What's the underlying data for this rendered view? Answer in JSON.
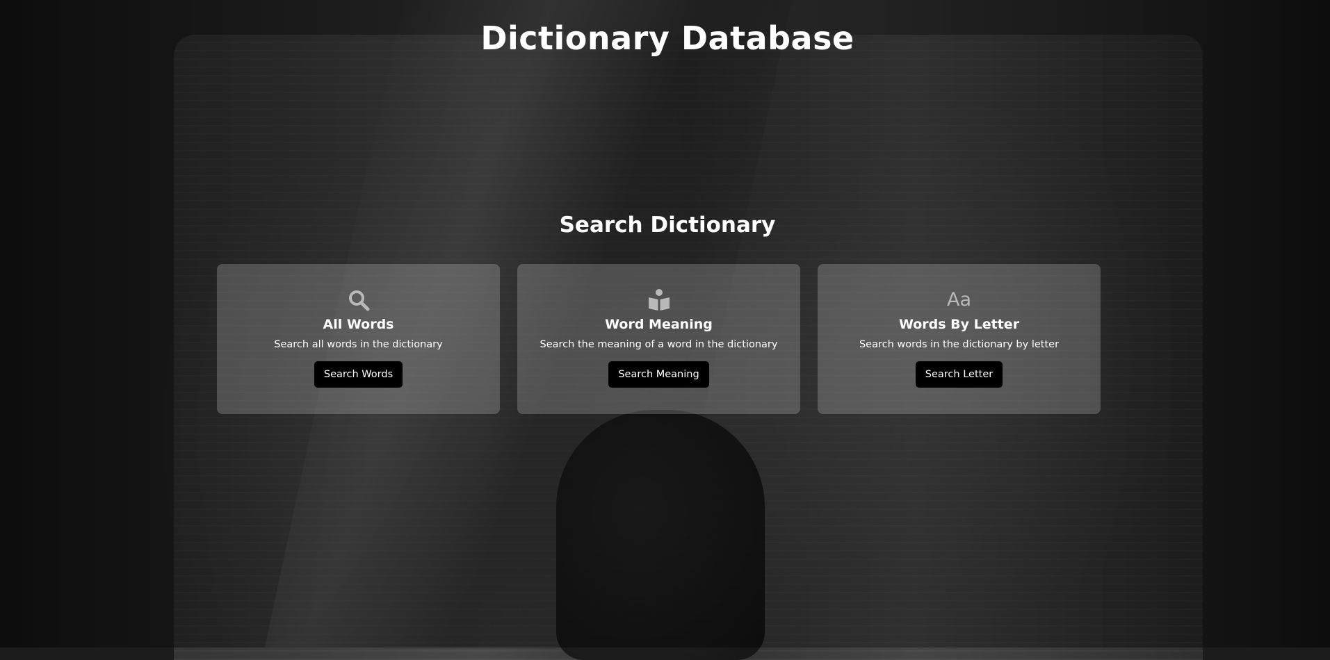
{
  "header": {
    "title": "Dictionary Database"
  },
  "main": {
    "section_title": "Search Dictionary",
    "cards": [
      {
        "icon": "search-icon",
        "title": "All Words",
        "description": "Search all words in the dictionary",
        "button_label": "Search Words"
      },
      {
        "icon": "book-reader-icon",
        "title": "Word Meaning",
        "description": "Search the meaning of a word in the dictionary",
        "button_label": "Search Meaning"
      },
      {
        "icon": "font-case-icon",
        "icon_glyph": "Aa",
        "title": "Words By Letter",
        "description": "Search words in the dictionary by letter",
        "button_label": "Search Letter"
      }
    ]
  },
  "colors": {
    "card_background": "rgba(255,255,255,0.2)",
    "button_background": "#000000",
    "text": "#ffffff",
    "icon": "#b9b9b9"
  }
}
